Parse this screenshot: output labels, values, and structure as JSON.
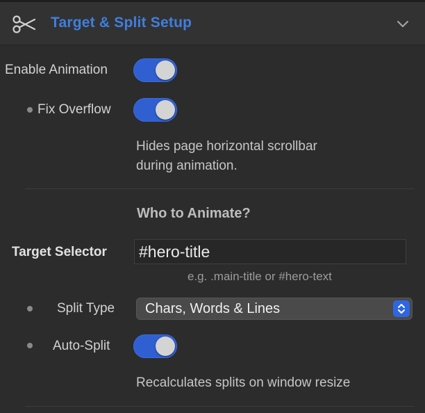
{
  "header": {
    "title": "Target & Split Setup",
    "icon": "scissors-icon",
    "collapse_icon": "chevron-down-icon"
  },
  "enable_animation": {
    "label": "Enable Animation",
    "enabled": true
  },
  "fix_overflow": {
    "label": "Fix Overflow",
    "enabled": true,
    "help_line1": "Hides page horizontal scrollbar",
    "help_line2": "during animation."
  },
  "section": {
    "title": "Who to Animate?"
  },
  "target_selector": {
    "label": "Target Selector",
    "value": "#hero-title",
    "example": "e.g. .main-title or #hero-text"
  },
  "split_type": {
    "label": "Split Type",
    "selected": "Chars, Words & Lines"
  },
  "auto_split": {
    "label": "Auto-Split",
    "enabled": true,
    "help": "Recalculates splits on window resize"
  },
  "colors": {
    "accent": "#3f7fe0",
    "toggle_on": "#2f5fd0",
    "background": "#2c2c2c",
    "header_bg": "#323232"
  }
}
